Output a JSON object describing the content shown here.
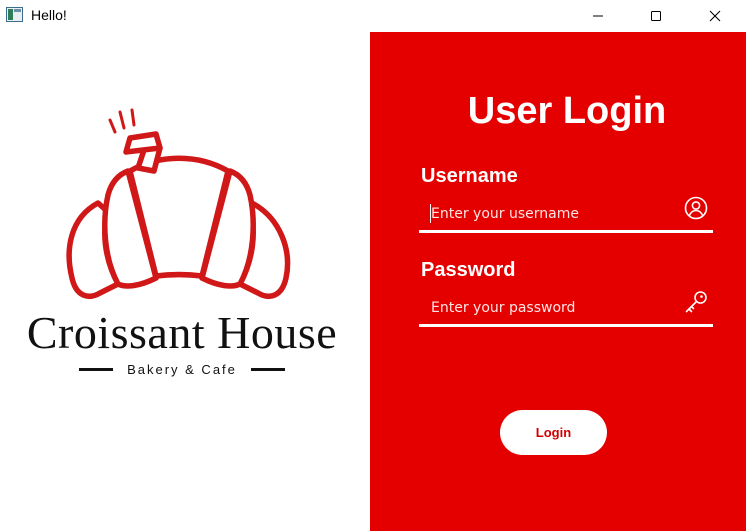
{
  "window": {
    "title": "Hello!",
    "controls": [
      "minimize",
      "maximize",
      "close"
    ]
  },
  "brand": {
    "name": "Croissant House",
    "tagline": "Bakery & Cafe",
    "logo_icon": "croissant-icon",
    "color": "#d01818"
  },
  "login": {
    "title": "User Login",
    "username_label": "Username",
    "username_placeholder": "Enter your username",
    "username_icon": "user-circle-icon",
    "password_label": "Password",
    "password_placeholder": "Enter your password",
    "password_icon": "key-icon",
    "button_label": "Login"
  },
  "colors": {
    "panel_background": "#e50000",
    "text_on_panel": "#ffffff",
    "button_text": "#d10000"
  }
}
